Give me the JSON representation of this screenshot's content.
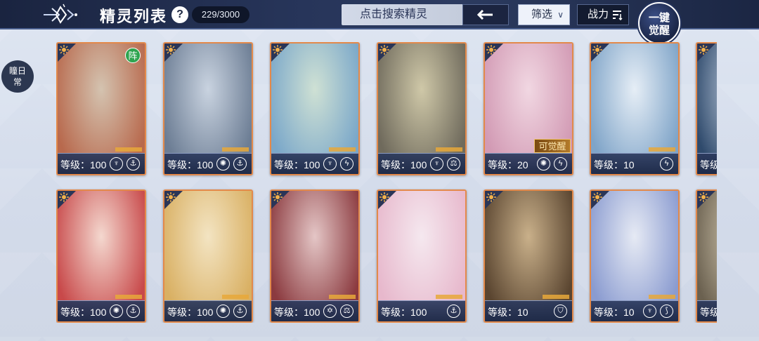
{
  "header": {
    "title": "精灵列表",
    "help": "?",
    "count": "229/3000",
    "search_placeholder": "点击搜索精灵",
    "filter_label": "筛选",
    "sort_label": "战力",
    "awaken_line1": "一键",
    "awaken_line2": "觉醒"
  },
  "side_tab": {
    "line1": "瞳日",
    "line2": "常"
  },
  "cards": [
    {
      "level": "等级：100",
      "badge": "阵",
      "bg": [
        "#d4c3b0",
        "#b8694d"
      ],
      "elements": [
        "crest",
        "anchor"
      ]
    },
    {
      "level": "等级：100",
      "bg": [
        "#c9d3e0",
        "#6c7d94"
      ],
      "elements": [
        "swirl",
        "anchor"
      ]
    },
    {
      "level": "等级：100",
      "bg": [
        "#cfe1d4",
        "#7aa7c9"
      ],
      "elements": [
        "crest",
        "bolt"
      ]
    },
    {
      "level": "等级：100",
      "bg": [
        "#cfc8a8",
        "#6f6a5c"
      ],
      "elements": [
        "crest",
        "scale"
      ]
    },
    {
      "level": "等级：20",
      "awaken_tag": "可觉醒",
      "bg": [
        "#f1d7e2",
        "#d29ab4"
      ],
      "elements": [
        "swirl",
        "bolt"
      ]
    },
    {
      "level": "等级：10",
      "bg": [
        "#e6eef6",
        "#7fa4c8"
      ],
      "elements": [
        "bolt"
      ]
    },
    {
      "level": "等级：",
      "bg": [
        "#c7d4e4",
        "#2f4a6c"
      ],
      "elements": []
    },
    {
      "level": "等级：100",
      "bg": [
        "#f4d8cf",
        "#c8494a"
      ],
      "elements": [
        "swirl",
        "anchor"
      ]
    },
    {
      "level": "等级：100",
      "bg": [
        "#f3e4c2",
        "#d9b063"
      ],
      "elements": [
        "swirl",
        "anchor"
      ]
    },
    {
      "level": "等级：100",
      "bg": [
        "#e4c6c6",
        "#8b3a3f"
      ],
      "elements": [
        "star",
        "scale"
      ]
    },
    {
      "level": "等级：100",
      "bg": [
        "#f5e8ef",
        "#e7b8cc"
      ],
      "elements": [
        "anchor"
      ]
    },
    {
      "level": "等级：10",
      "bg": [
        "#c9b08a",
        "#5a4530"
      ],
      "elements": [
        "shield"
      ]
    },
    {
      "level": "等级：10",
      "bg": [
        "#e6eaf4",
        "#8a9bd0"
      ],
      "elements": [
        "crest",
        "wing"
      ]
    },
    {
      "level": "等级：",
      "bg": [
        "#d8cdb4",
        "#6b6150"
      ],
      "elements": []
    }
  ],
  "icons": {
    "back": "back-crystal-icon",
    "search": "arrow-left-icon",
    "filter": "chevron-down-icon",
    "sort": "sort-descending-icon",
    "star": "sun-emblem-icon"
  }
}
